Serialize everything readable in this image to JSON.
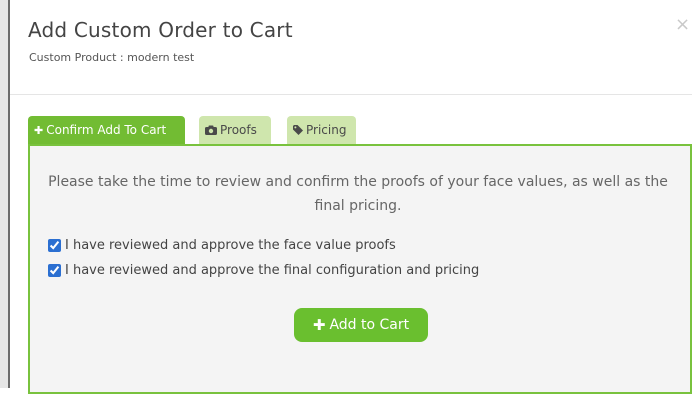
{
  "modal": {
    "title": "Add Custom Order to Cart",
    "subtitle": "Custom Product : modern test",
    "close_glyph": "×"
  },
  "tabs": [
    {
      "label": "Confirm Add To Cart",
      "icon": "plus-icon",
      "active": true
    },
    {
      "label": "Proofs",
      "icon": "camera-icon",
      "active": false
    },
    {
      "label": "Pricing",
      "icon": "tag-icon",
      "active": false
    }
  ],
  "panel": {
    "message": "Please take the time to review and confirm the proofs of your face values, as well as the final pricing.",
    "checkboxes": [
      {
        "label": "I have reviewed and approve the face value proofs",
        "checked": true
      },
      {
        "label": "I have reviewed and approve the final configuration and pricing",
        "checked": true
      }
    ],
    "button_label": "Add to Cart"
  },
  "colors": {
    "accent_green": "#72bc33",
    "tab_inactive": "#cfe6ad",
    "panel_border": "#79c23d",
    "button_green": "#6abf2f",
    "checkbox_blue": "#2b6fd1"
  }
}
